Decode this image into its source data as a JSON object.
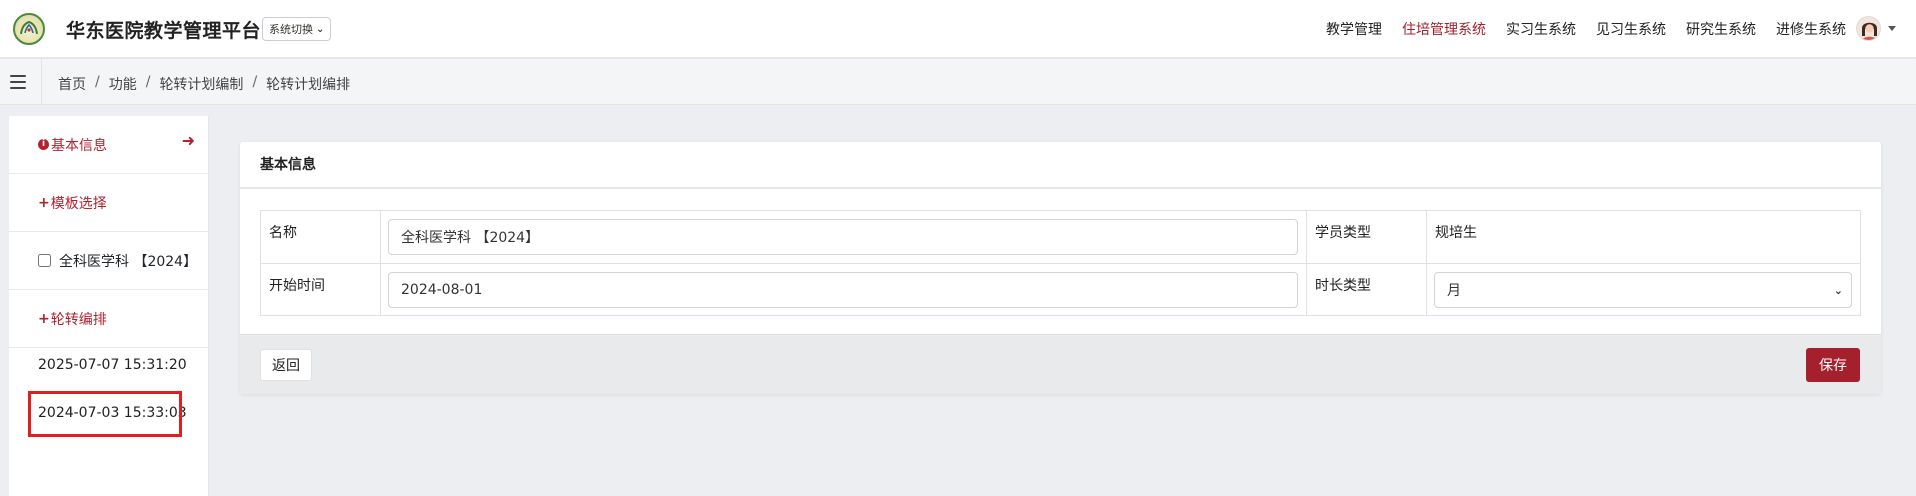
{
  "header": {
    "title": "华东医院教学管理平台",
    "system_switch_label": "系统切换",
    "nav": [
      {
        "label": "教学管理",
        "active": false
      },
      {
        "label": "住培管理系统",
        "active": true
      },
      {
        "label": "实习生系统",
        "active": false
      },
      {
        "label": "见习生系统",
        "active": false
      },
      {
        "label": "研究生系统",
        "active": false
      },
      {
        "label": "进修生系统",
        "active": false
      }
    ]
  },
  "breadcrumb": [
    "首页",
    "功能",
    "轮转计划编制",
    "轮转计划编排"
  ],
  "sidebar": {
    "basic_info": "基本信息",
    "template_select": "模板选择",
    "template_item": "全科医学科 【2024】",
    "rotation_arrange": "轮转编排",
    "dates": [
      "2025-07-07 15:31:20",
      "2024-07-03 15:33:03"
    ]
  },
  "card": {
    "title": "基本信息",
    "fields": {
      "name_label": "名称",
      "name_value": "全科医学科 【2024】",
      "student_type_label": "学员类型",
      "student_type_value": "规培生",
      "start_time_label": "开始时间",
      "start_time_value": "2024-08-01",
      "duration_type_label": "时长类型",
      "duration_type_value": "月"
    },
    "back_button": "返回",
    "save_button": "保存"
  },
  "colors": {
    "accent": "#a4202c",
    "highlight": "#e0201f"
  }
}
